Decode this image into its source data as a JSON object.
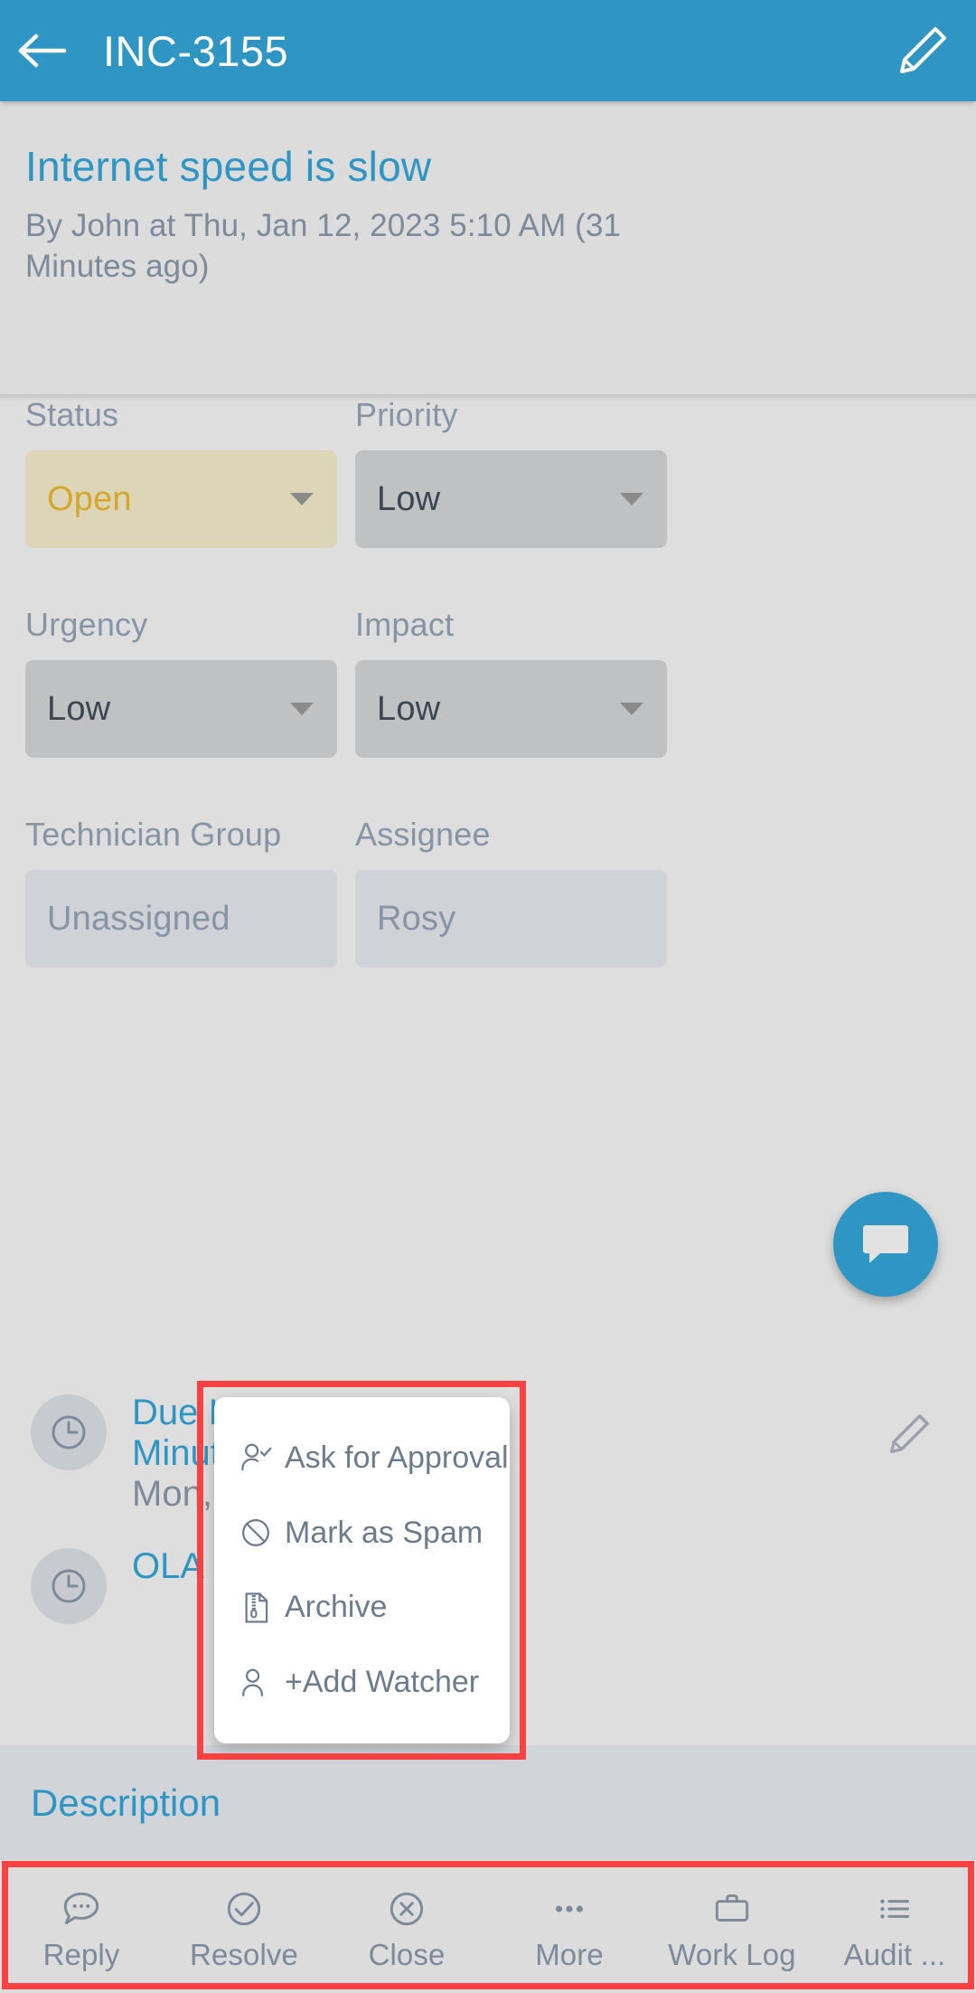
{
  "appbar": {
    "back_icon": "arrow-left-icon",
    "title": "INC-3155",
    "edit_icon": "pencil-icon"
  },
  "ticket": {
    "title": "Internet speed is slow",
    "subtitle": "By John at Thu, Jan 12, 2023 5:10 AM (31 Minutes ago)"
  },
  "fields": {
    "status": {
      "label": "Status",
      "value": "Open"
    },
    "priority": {
      "label": "Priority",
      "value": "Low"
    },
    "urgency": {
      "label": "Urgency",
      "value": "Low"
    },
    "impact": {
      "label": "Impact",
      "value": "Low"
    },
    "technician_group": {
      "label": "Technician Group",
      "value": "Unassigned"
    },
    "assignee": {
      "label": "Assignee",
      "value": "Rosy"
    }
  },
  "sla": {
    "due": {
      "line1": "Due I",
      "line2": "Minut",
      "line3": "Mon,",
      "icon": "clock-icon",
      "edit_icon": "pencil-icon"
    },
    "ola": {
      "line1": "OLA I",
      "icon": "clock-icon"
    }
  },
  "description": {
    "label": "Description"
  },
  "fab": {
    "icon": "chat-bubble-icon"
  },
  "popup_menu": {
    "items": [
      {
        "label": "Ask for Approval",
        "icon": "person-check-icon"
      },
      {
        "label": "Mark as Spam",
        "icon": "block-circle-icon"
      },
      {
        "label": "Archive",
        "icon": "archive-file-icon"
      },
      {
        "label": "+Add Watcher",
        "icon": "person-add-icon"
      }
    ]
  },
  "toolbar": {
    "items": [
      {
        "label": "Reply",
        "icon": "chat-dots-icon"
      },
      {
        "label": "Resolve",
        "icon": "check-circle-icon"
      },
      {
        "label": "Close",
        "icon": "x-circle-icon"
      },
      {
        "label": "More",
        "icon": "ellipsis-icon"
      },
      {
        "label": "Work Log",
        "icon": "briefcase-icon"
      },
      {
        "label": "Audit ...",
        "icon": "list-icon"
      }
    ]
  },
  "colors": {
    "accent_blue": "#2f96c4",
    "page_bg": "#dedede",
    "status_bg": "#ddd5b7",
    "status_text": "#d5a72b",
    "field_grey": "#bfc1c3",
    "field_disabled": "#cfd3d7",
    "muted_text": "#7d8a99",
    "annotation_red": "#fa4141"
  }
}
